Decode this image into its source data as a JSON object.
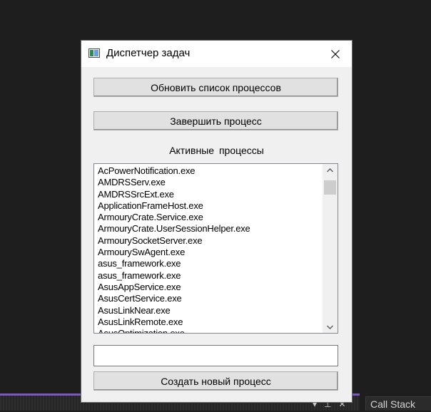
{
  "window": {
    "title": "Диспетчер задач"
  },
  "buttons": {
    "refresh": "Обновить список процессов",
    "kill": "Завершить процесс",
    "create": "Создать новый процесс"
  },
  "section_label": "Активные процессы",
  "process_list": [
    "AcPowerNotification.exe",
    "AMDRSServ.exe",
    "AMDRSSrcExt.exe",
    "ApplicationFrameHost.exe",
    "ArmouryCrate.Service.exe",
    "ArmouryCrate.UserSessionHelper.exe",
    "ArmourySocketServer.exe",
    "ArmourySwAgent.exe",
    "asus_framework.exe",
    "asus_framework.exe",
    "AsusAppService.exe",
    "AsusCertService.exe",
    "AsusLinkNear.exe",
    "AsusLinkRemote.exe",
    "AsusOptimization.exe"
  ],
  "new_process_input": {
    "value": ""
  },
  "ide": {
    "panel_tab": "Call Stack",
    "pin_glyph": "⊥",
    "close_glyph": "✕",
    "dropdown_glyph": "▾"
  },
  "icons": {
    "app": "task-manager-icon",
    "close": "close-icon",
    "scroll_up": "chevron-up-icon",
    "scroll_down": "chevron-down-icon"
  }
}
